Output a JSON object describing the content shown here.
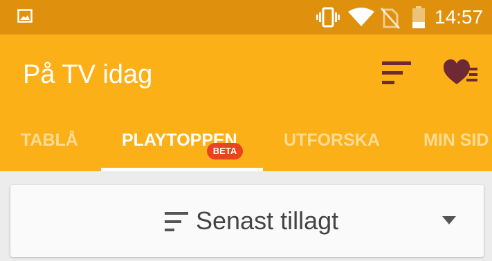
{
  "status_bar": {
    "time": "14:57",
    "icons": [
      "gallery-icon",
      "vibrate-icon",
      "wifi-icon",
      "no-sim-icon",
      "battery-icon"
    ],
    "battery_level": 0.3
  },
  "app_bar": {
    "title": "På TV idag",
    "actions": [
      "sort-icon",
      "favorites-list-icon"
    ]
  },
  "tabs": [
    {
      "label": "TABLÅ",
      "active": false
    },
    {
      "label": "PLAYTOPPEN",
      "active": true,
      "badge": "BETA"
    },
    {
      "label": "UTFORSKA",
      "active": false
    },
    {
      "label": "MIN SID",
      "active": false
    }
  ],
  "sort_dropdown": {
    "selected": "Senast tillagt",
    "icons": [
      "sort-lines-icon",
      "caret-down-icon"
    ]
  },
  "colors": {
    "status_bar": "#df900c",
    "app_bar": "#fcb017",
    "badge": "#e8451d",
    "icon_dark": "#6d2a34",
    "background": "#ececec"
  }
}
